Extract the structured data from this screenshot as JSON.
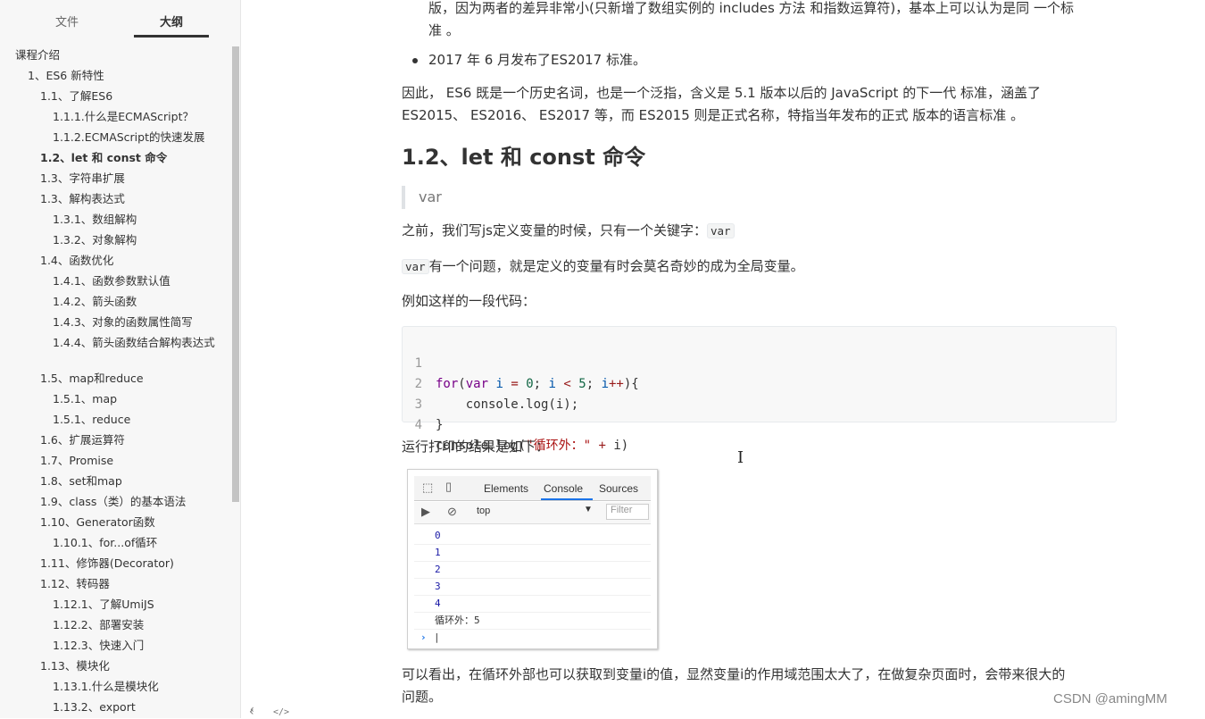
{
  "sidebar": {
    "tabs": {
      "files": "文件",
      "outline": "大纲"
    },
    "outline": [
      {
        "label": "课程介绍"
      },
      {
        "label": "1、ES6 新特性"
      },
      {
        "label": "1.1、了解ES6"
      },
      {
        "label": "1.1.1.什么是ECMAScript？"
      },
      {
        "label": "1.1.2.ECMAScript的快速发展"
      },
      {
        "label": "1.2、let 和 const 命令",
        "active": true
      },
      {
        "label": "1.3、字符串扩展"
      },
      {
        "label": "1.3、解构表达式"
      },
      {
        "label": "1.3.1、数组解构"
      },
      {
        "label": "1.3.2、对象解构"
      },
      {
        "label": "1.4、函数优化"
      },
      {
        "label": "1.4.1、函数参数默认值"
      },
      {
        "label": "1.4.2、箭头函数"
      },
      {
        "label": "1.4.3、对象的函数属性简写"
      },
      {
        "label": "1.4.4、箭头函数结合解构表达式"
      },
      {
        "label": "1.5、map和reduce"
      },
      {
        "label": "1.5.1、map"
      },
      {
        "label": "1.5.1、reduce"
      },
      {
        "label": "1.6、扩展运算符"
      },
      {
        "label": "1.7、Promise"
      },
      {
        "label": "1.8、set和map"
      },
      {
        "label": "1.9、class（类）的基本语法"
      },
      {
        "label": "1.10、Generator函数"
      },
      {
        "label": "1.10.1、for...of循环"
      },
      {
        "label": "1.11、修饰器(Decorator)"
      },
      {
        "label": "1.12、转码器"
      },
      {
        "label": "1.12.1、了解UmiJS"
      },
      {
        "label": "1.12.2、部署安装"
      },
      {
        "label": "1.12.3、快速入门"
      },
      {
        "label": "1.13、模块化"
      },
      {
        "label": "1.13.1.什么是模块化"
      },
      {
        "label": "1.13.2、export"
      }
    ],
    "bottom_icons": [
      "chevron-left-icon",
      "code-icon"
    ]
  },
  "content": {
    "top_line1": "版，因为两者的差异非常小(只新增了数组实例的 includes 方法 和指数运算符)，基本上可以认为是同 一个标",
    "top_line2": "准 。",
    "bullet": "2017 年 6 月发布了ES2017 标准。",
    "para1_line1": "因此， ES6 既是一个历史名词，也是一个泛指，含义是 5.1 版本以后的 JavaScript 的下一代 标准，涵盖了",
    "para1_line2": "ES2015、 ES2016、 ES2017 等，而 ES2015 则是正式名称，特指当年发布的正式 版本的语言标准 。",
    "heading": "1.2、let 和 const 命令",
    "quote": "var",
    "p_before": "之前，我们写js定义变量的时候，只有一个关键字：",
    "code_var": "var",
    "p_var_rest": "有一个问题，就是定义的变量有时会莫名奇妙的成为全局变量。",
    "p_example": "例如这样的一段代码：",
    "code_lines": [
      "for(var i = 0; i < 5; i++){",
      "    console.log(i);",
      "}",
      "console.log(\"循环外：\" + i)"
    ],
    "p_result": "运行打印的结果是如下：",
    "p_conclusion_line1": "可以看出，在循环外部也可以获取到变量i的值，显然变量i的作用域范围太大了，在做复杂页面时，会带来很大的",
    "p_conclusion_line2": "问题。"
  },
  "devtools": {
    "tabs": [
      "Elements",
      "Console",
      "Sources"
    ],
    "active_tab": "Console",
    "context": "top",
    "filter_placeholder": "Filter",
    "output": [
      "0",
      "1",
      "2",
      "3",
      "4",
      "循环外：5"
    ],
    "prompt": "›"
  },
  "watermark": "CSDN @amingMM"
}
